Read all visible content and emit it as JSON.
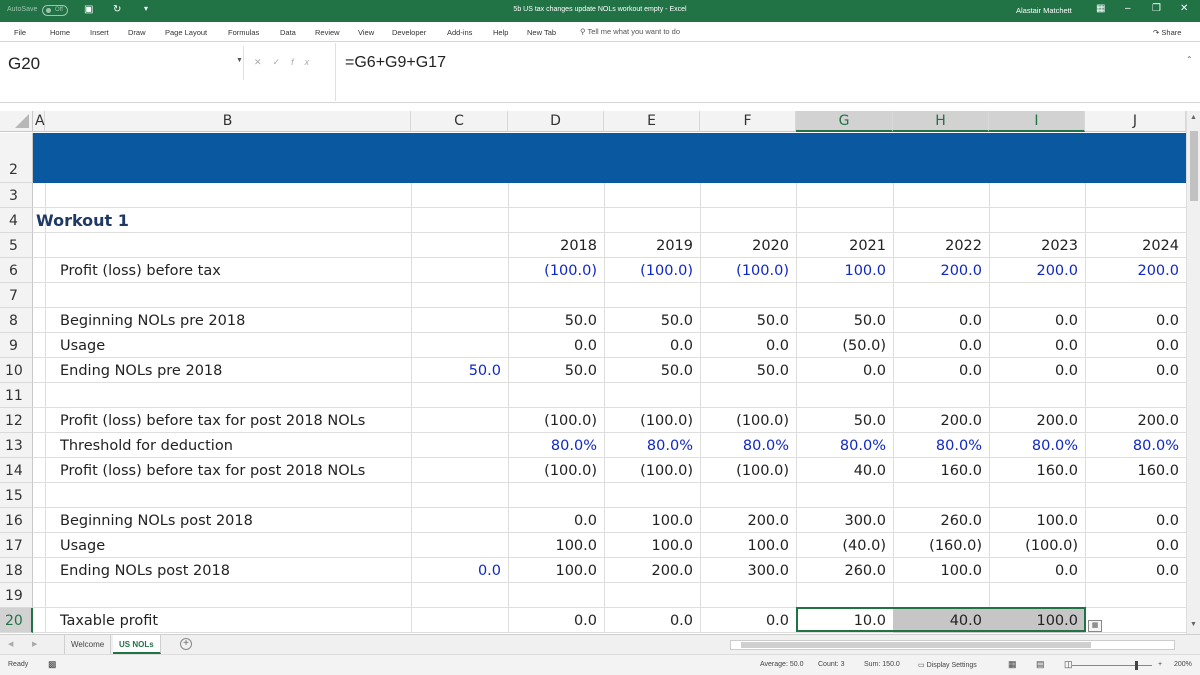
{
  "titlebar": {
    "autosave_label": "AutoSave",
    "autosave_state": "Off",
    "document_title": "5b US tax changes update NOLs workout empty  -  Excel",
    "user_name": "Alastair Matchett"
  },
  "ribbon": {
    "tabs": [
      "File",
      "Home",
      "Insert",
      "Draw",
      "Page Layout",
      "Formulas",
      "Data",
      "Review",
      "View",
      "Developer",
      "Add-ins",
      "Help",
      "New Tab"
    ],
    "tell_me": "Tell me what you want to do",
    "share": "Share"
  },
  "formula_bar": {
    "name_box": "G20",
    "formula": "=G6+G9+G17"
  },
  "grid": {
    "columns": [
      "A",
      "B",
      "C",
      "D",
      "E",
      "F",
      "G",
      "H",
      "I",
      "J"
    ],
    "selected_columns": [
      "G",
      "H",
      "I"
    ],
    "row_numbers": [
      "2",
      "3",
      "4",
      "5",
      "6",
      "7",
      "8",
      "9",
      "10",
      "11",
      "12",
      "13",
      "14",
      "15",
      "16",
      "17",
      "18",
      "19",
      "20"
    ],
    "selected_row": "20",
    "section_title": "Workout 1",
    "years": [
      "2018",
      "2019",
      "2020",
      "2021",
      "2022",
      "2023",
      "2024"
    ],
    "rows": [
      {
        "row": "6",
        "label": "Profit (loss) before tax",
        "c": "",
        "values": [
          "(100.0)",
          "(100.0)",
          "(100.0)",
          "100.0",
          "200.0",
          "200.0",
          "200.0"
        ],
        "blue": true
      },
      {
        "row": "8",
        "label": "Beginning NOLs pre 2018",
        "c": "",
        "values": [
          "50.0",
          "50.0",
          "50.0",
          "50.0",
          "0.0",
          "0.0",
          "0.0"
        ],
        "blue": false
      },
      {
        "row": "9",
        "label": "Usage",
        "c": "",
        "values": [
          "0.0",
          "0.0",
          "0.0",
          "(50.0)",
          "0.0",
          "0.0",
          "0.0"
        ],
        "blue": false
      },
      {
        "row": "10",
        "label": "Ending NOLs pre 2018",
        "c": "50.0",
        "values": [
          "50.0",
          "50.0",
          "50.0",
          "0.0",
          "0.0",
          "0.0",
          "0.0"
        ],
        "blue": false
      },
      {
        "row": "12",
        "label": "Profit (loss) before tax for post 2018 NOLs",
        "c": "",
        "values": [
          "(100.0)",
          "(100.0)",
          "(100.0)",
          "50.0",
          "200.0",
          "200.0",
          "200.0"
        ],
        "blue": false
      },
      {
        "row": "13",
        "label": "Threshold for deduction",
        "c": "",
        "values": [
          "80.0%",
          "80.0%",
          "80.0%",
          "80.0%",
          "80.0%",
          "80.0%",
          "80.0%"
        ],
        "blue": true
      },
      {
        "row": "14",
        "label": "Profit (loss) before tax for post 2018 NOLs",
        "c": "",
        "values": [
          "(100.0)",
          "(100.0)",
          "(100.0)",
          "40.0",
          "160.0",
          "160.0",
          "160.0"
        ],
        "blue": false
      },
      {
        "row": "16",
        "label": "Beginning NOLs post 2018",
        "c": "",
        "values": [
          "0.0",
          "100.0",
          "200.0",
          "300.0",
          "260.0",
          "100.0",
          "0.0"
        ],
        "blue": false
      },
      {
        "row": "17",
        "label": "Usage",
        "c": "",
        "values": [
          "100.0",
          "100.0",
          "100.0",
          "(40.0)",
          "(160.0)",
          "(100.0)",
          "0.0"
        ],
        "blue": false
      },
      {
        "row": "18",
        "label": "Ending NOLs post 2018",
        "c": "0.0",
        "values": [
          "100.0",
          "200.0",
          "300.0",
          "260.0",
          "100.0",
          "0.0",
          "0.0"
        ],
        "blue": false
      },
      {
        "row": "20",
        "label": "Taxable profit",
        "c": "",
        "values": [
          "0.0",
          "0.0",
          "0.0",
          "10.0",
          "40.0",
          "100.0",
          ""
        ],
        "blue": false
      }
    ]
  },
  "sheets": {
    "tabs": [
      "Welcome",
      "US NOLs"
    ],
    "active": "US NOLs"
  },
  "status": {
    "mode": "Ready",
    "average": "Average: 50.0",
    "count": "Count: 3",
    "sum": "Sum: 150.0",
    "display_settings": "Display Settings",
    "zoom": "200%"
  },
  "colors": {
    "excel_green": "#217346",
    "title_band": "#0a58a0",
    "input_blue": "#1028c4",
    "selection_fill": "#c6c6c6"
  }
}
